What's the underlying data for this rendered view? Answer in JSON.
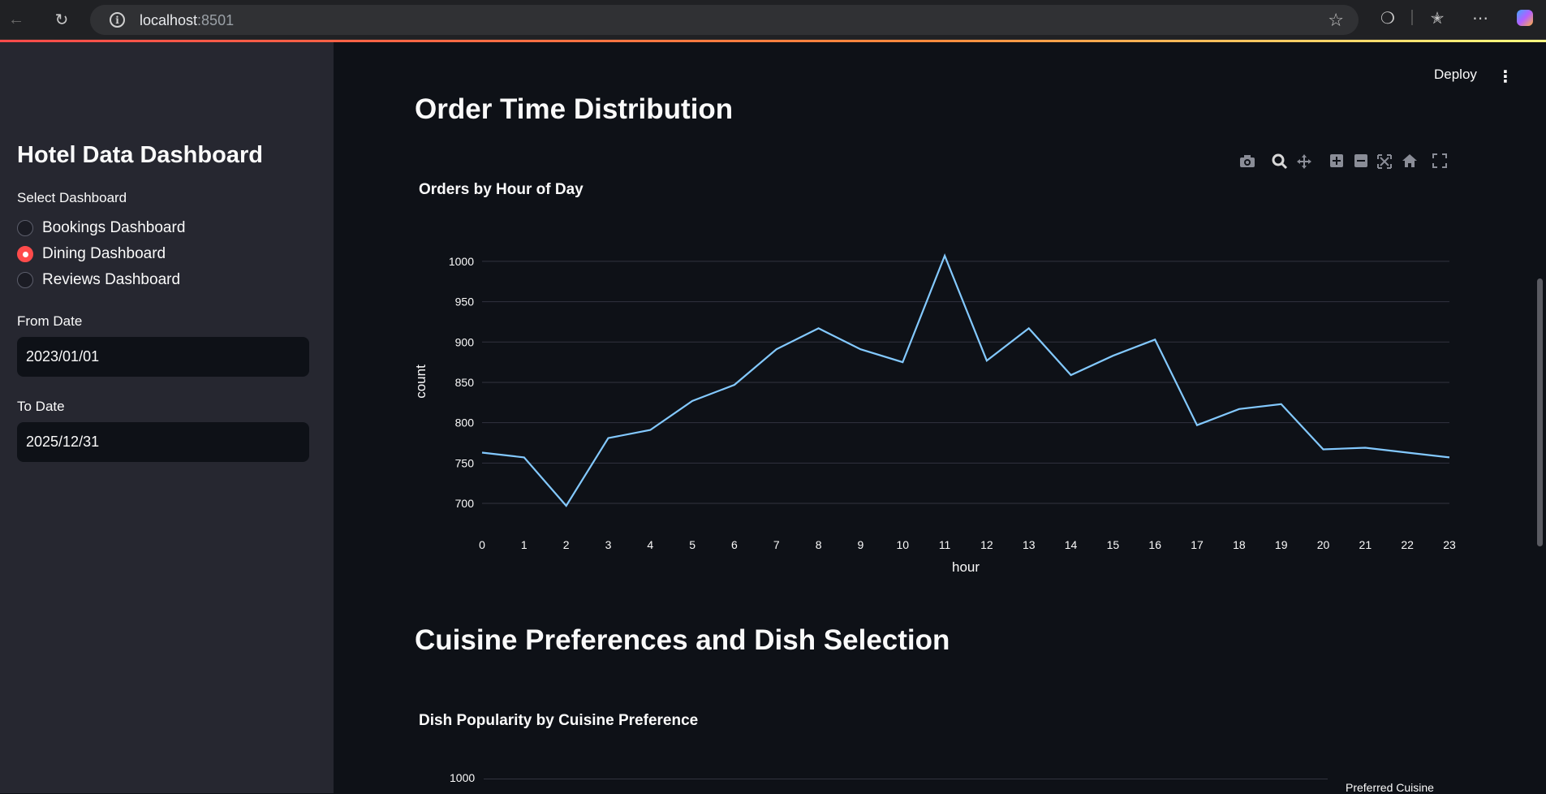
{
  "browser": {
    "url_host": "localhost",
    "url_port": ":8501"
  },
  "sidebar": {
    "title": "Hotel Data Dashboard",
    "select_label": "Select Dashboard",
    "options": [
      {
        "label": "Bookings Dashboard",
        "checked": false
      },
      {
        "label": "Dining Dashboard",
        "checked": true
      },
      {
        "label": "Reviews Dashboard",
        "checked": false
      }
    ],
    "from_label": "From Date",
    "from_value": "2023/01/01",
    "to_label": "To Date",
    "to_value": "2025/12/31"
  },
  "header": {
    "deploy_label": "Deploy",
    "menu_glyph": "⋮"
  },
  "main": {
    "section1_title": "Order Time Distribution",
    "section2_title": "Cuisine Preferences and Dish Selection",
    "chart2_title": "Dish Popularity by Cuisine Preference",
    "chart2_first_tick": "1000",
    "chart2_legend_title": "Preferred Cuisine"
  },
  "colors": {
    "line": "#83c9ff",
    "accent": "#ff4b4b",
    "grid": "#31333f"
  },
  "chart_data": {
    "type": "line",
    "title": "Orders by Hour of Day",
    "xlabel": "hour",
    "ylabel": "count",
    "x": [
      0,
      1,
      2,
      3,
      4,
      5,
      6,
      7,
      8,
      9,
      10,
      11,
      12,
      13,
      14,
      15,
      16,
      17,
      18,
      19,
      20,
      21,
      22,
      23
    ],
    "values": [
      763,
      757,
      697,
      781,
      791,
      827,
      847,
      891,
      917,
      891,
      875,
      1007,
      877,
      917,
      859,
      883,
      903,
      797,
      817,
      823,
      767,
      769,
      763,
      757
    ],
    "yticks": [
      700,
      750,
      800,
      850,
      900,
      950,
      1000
    ],
    "ylim": [
      690,
      1012
    ],
    "grid": true
  }
}
